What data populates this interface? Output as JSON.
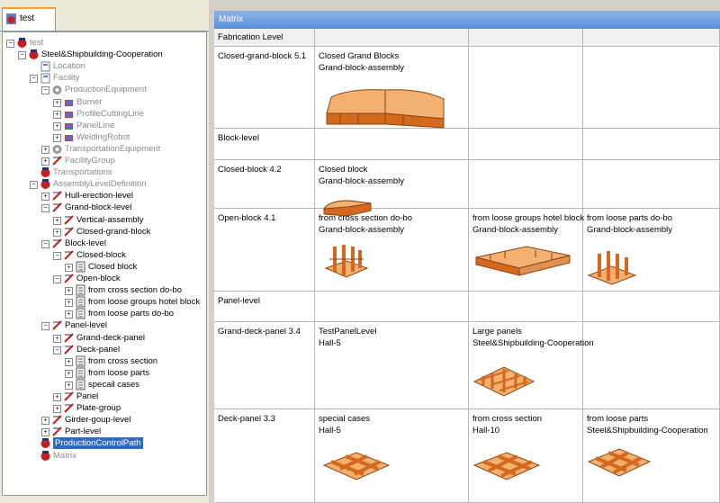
{
  "left_panel": {
    "tab_label": "test",
    "tree": [
      {
        "label": "test",
        "level": 0,
        "style": "gray"
      },
      {
        "label": "Steel&Shipbuilding-Cooperation",
        "level": 1
      },
      {
        "label": "Location",
        "level": 2,
        "style": "gray"
      },
      {
        "label": "Facility",
        "level": 2,
        "style": "gray"
      },
      {
        "label": "ProductionEquipment",
        "level": 3,
        "style": "gray"
      },
      {
        "label": "Burner",
        "level": 4,
        "style": "gray"
      },
      {
        "label": "ProfileCuttingLine",
        "level": 4,
        "style": "gray"
      },
      {
        "label": "PanelLine",
        "level": 4,
        "style": "gray"
      },
      {
        "label": "WeldingRobot",
        "level": 4,
        "style": "gray"
      },
      {
        "label": "TransportationEquipment",
        "level": 3,
        "style": "gray"
      },
      {
        "label": "FacilityGroup",
        "level": 3,
        "style": "gray"
      },
      {
        "label": "Transportations",
        "level": 2,
        "style": "gray"
      },
      {
        "label": "AssemblyLevelDefinition",
        "level": 2,
        "style": "gray"
      },
      {
        "label": "Hull-erection-level",
        "level": 3
      },
      {
        "label": "Grand-block-level",
        "level": 3
      },
      {
        "label": "Vertical-assembly",
        "level": 4
      },
      {
        "label": "Closed-grand-block",
        "level": 4
      },
      {
        "label": "Block-level",
        "level": 3
      },
      {
        "label": "Closed-block",
        "level": 4
      },
      {
        "label": "Closed block",
        "level": 5
      },
      {
        "label": "Open-block",
        "level": 4
      },
      {
        "label": "from cross section do-bo",
        "level": 5
      },
      {
        "label": "from loose groups hotel block",
        "level": 5
      },
      {
        "label": "from loose parts do-bo",
        "level": 5
      },
      {
        "label": "Panel-level",
        "level": 3
      },
      {
        "label": "Grand-deck-panel",
        "level": 4
      },
      {
        "label": "Deck-panel",
        "level": 4
      },
      {
        "label": "from cross section",
        "level": 5
      },
      {
        "label": "from loose parts",
        "level": 5
      },
      {
        "label": "specail cases",
        "level": 5
      },
      {
        "label": "Panel",
        "level": 4
      },
      {
        "label": "Plate-group",
        "level": 4
      },
      {
        "label": "Girder-goup-level",
        "level": 3
      },
      {
        "label": "Part-level",
        "level": 3
      },
      {
        "label": "ProductionControlPath",
        "level": 2,
        "style": "selected"
      },
      {
        "label": "Matrix",
        "level": 2,
        "style": "gray"
      }
    ]
  },
  "matrix": {
    "title": "Matrix",
    "header": "Fabrication Level",
    "rows": [
      {
        "label": "Closed-grand-block 5.1",
        "cells": [
          {
            "line1": "Closed Grand Blocks",
            "line2": "Grand-block-assembly",
            "illustration": "grand-block-illustration"
          },
          null,
          null
        ]
      },
      {
        "label": "Block-level",
        "cells": [
          null,
          null,
          null
        ]
      },
      {
        "label": "Closed-block 4.2",
        "cells": [
          {
            "line1": "Closed block",
            "line2": "Grand-block-assembly",
            "illustration": "closed-block-illustration"
          },
          null,
          null
        ]
      },
      {
        "label": "Open-block 4.1",
        "cells": [
          {
            "line1": "from cross section do-bo",
            "line2": "Grand-block-assembly",
            "illustration": "open-block-cross-illustration"
          },
          {
            "line1": "from loose groups hotel block",
            "line2": "Grand-block-assembly",
            "illustration": "hotel-block-illustration"
          },
          {
            "line1": "from loose parts do-bo",
            "line2": "Grand-block-assembly",
            "illustration": "open-block-parts-illustration"
          }
        ]
      },
      {
        "label": "Panel-level",
        "cells": [
          null,
          null,
          null
        ]
      },
      {
        "label": "Grand-deck-panel 3.4",
        "cells": [
          {
            "line1": "TestPanelLevel",
            "line2": "Hall-5"
          },
          {
            "line1": "Large panels",
            "line2": "Steel&Shipbuilding-Cooperation",
            "illustration": "large-panel-illustration"
          },
          null
        ]
      },
      {
        "label": "Deck-panel 3.3",
        "cells": [
          {
            "line1": "special cases",
            "line2": "Hall-5",
            "illustration": "special-panel-illustration"
          },
          {
            "line1": "from cross section",
            "line2": "Hall-10",
            "illustration": "cross-panel-illustration"
          },
          {
            "line1": "from loose parts",
            "line2": "Steel&Shipbuilding-Cooperation",
            "illustration": "loose-panel-illustration"
          }
        ]
      }
    ]
  },
  "colors": {
    "orange": "#d2691e",
    "orange_light": "#f4b070",
    "selection": "#316ac5",
    "header_blue": "#6a9be0"
  }
}
